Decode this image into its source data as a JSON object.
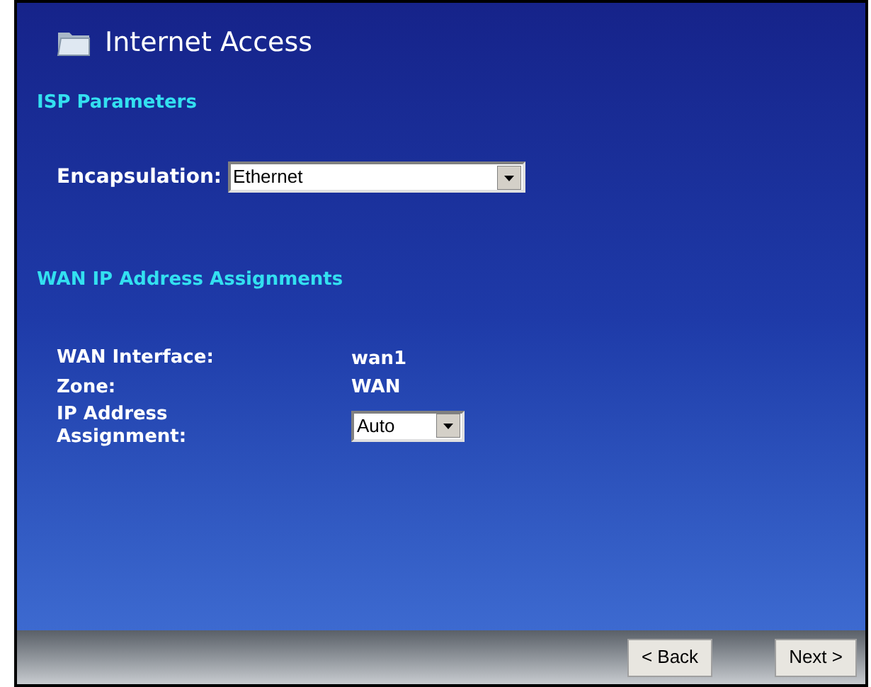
{
  "title": "Internet Access",
  "isp_section": {
    "heading": "ISP Parameters",
    "encapsulation": {
      "label": "Encapsulation:",
      "value": "Ethernet"
    }
  },
  "wan_section": {
    "heading": "WAN IP Address Assignments",
    "rows": [
      {
        "kind": "text",
        "label": "WAN Interface:",
        "value": "wan1"
      },
      {
        "kind": "text",
        "label": "Zone:",
        "value": "WAN"
      },
      {
        "kind": "select",
        "label": "IP Address Assignment:",
        "value": "Auto"
      }
    ]
  },
  "buttons": [
    "< Back",
    "Next >"
  ]
}
